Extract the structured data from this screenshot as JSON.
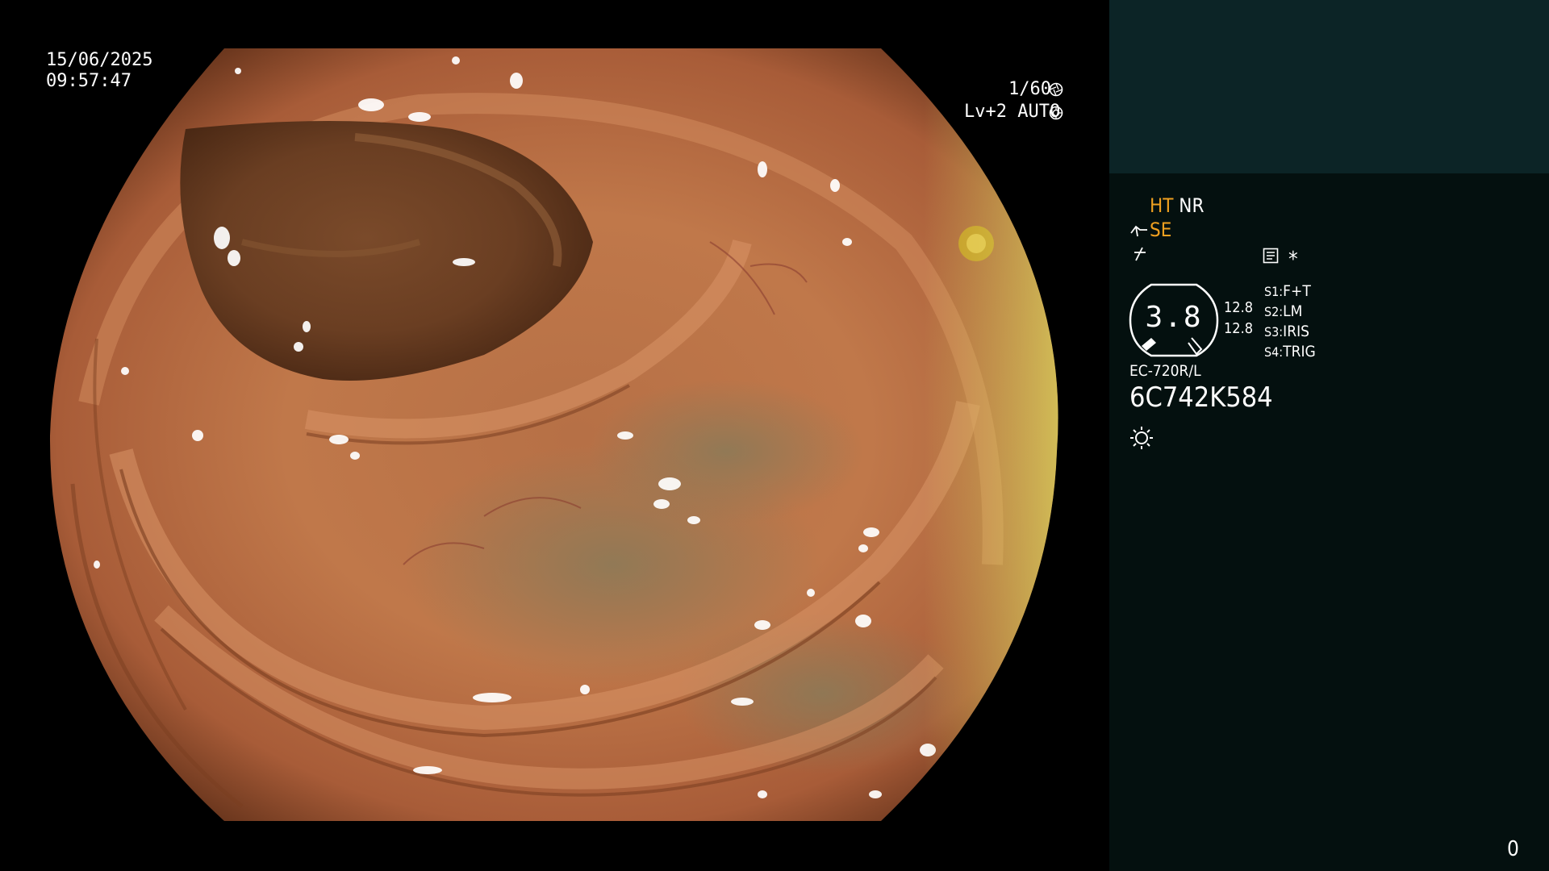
{
  "overlay": {
    "date": "15/06/2025",
    "time": "09:57:47",
    "shutter": "1/60",
    "shutter_icon": "aperture-icon",
    "exposure_level": "Lv+2",
    "exposure_mode": "AUTO",
    "exposure_icon": "iris-icon"
  },
  "panel": {
    "ht": "HT",
    "nr": "NR",
    "se": "SE",
    "se_icon": "enhance-curve-icon",
    "structure_icon": "structure-icon",
    "record_icon": "record-icon",
    "asterisk": "*",
    "gauge": {
      "value": "3.8"
    },
    "readouts": [
      "12.8",
      "12.8"
    ],
    "switches": [
      {
        "key": "S1:",
        "value": "F+T"
      },
      {
        "key": "S2:",
        "value": "LM"
      },
      {
        "key": "S3:",
        "value": "IRIS"
      },
      {
        "key": "S4:",
        "value": "TRIG"
      }
    ],
    "scope_model": "EC-720R/L",
    "serial": "6C742K584",
    "light_icon": "brightness-icon",
    "counter": "0"
  },
  "colors": {
    "accent_orange": "#f0a020",
    "panel_top": "#0c2426",
    "panel_bg": "#04100f"
  }
}
